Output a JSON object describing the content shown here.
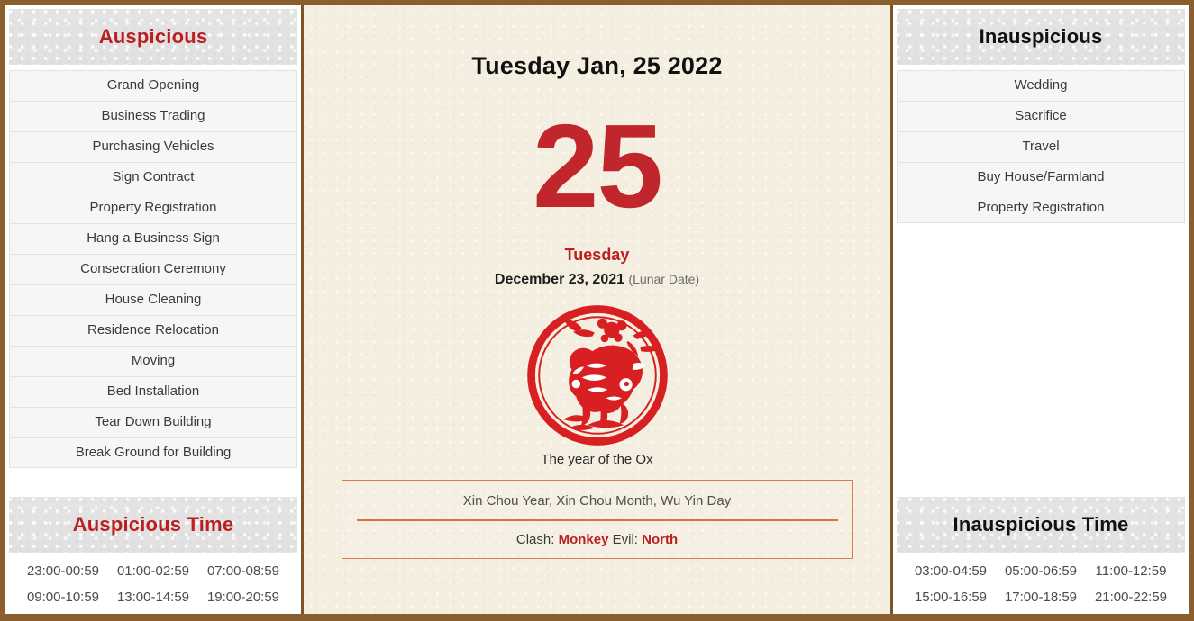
{
  "theme": {
    "frame_brown": "#8a5f2d",
    "accent_red": "#bb1f1f",
    "day_red": "#c0262c",
    "paper_cream": "#f4efe0",
    "box_orange": "#dc7a4c"
  },
  "left_panel": {
    "header": "Auspicious",
    "items": [
      "Grand Opening",
      "Business Trading",
      "Purchasing Vehicles",
      "Sign Contract",
      "Property Registration",
      "Hang a Business Sign",
      "Consecration Ceremony",
      "House Cleaning",
      "Residence Relocation",
      "Moving",
      "Bed Installation",
      "Tear Down Building",
      "Break Ground for Building"
    ],
    "time_header": "Auspicious Time",
    "times": [
      "23:00-00:59",
      "01:00-02:59",
      "07:00-08:59",
      "09:00-10:59",
      "13:00-14:59",
      "19:00-20:59"
    ]
  },
  "center": {
    "full_date": "Tuesday Jan, 25 2022",
    "day_number": "25",
    "weekday": "Tuesday",
    "lunar_date": "December 23, 2021",
    "lunar_tag": "(Lunar Date)",
    "zodiac_caption": "The year of the Ox",
    "zodiac_icon": "ox-papercut-icon",
    "ganzhi": "Xin Chou Year, Xin Chou Month, Wu Yin Day",
    "clash_prefix": "Clash:",
    "clash_value": "Monkey",
    "evil_prefix": "Evil:",
    "evil_value": "North"
  },
  "right_panel": {
    "header": "Inauspicious",
    "items": [
      "Wedding",
      "Sacrifice",
      "Travel",
      "Buy House/Farmland",
      "Property Registration"
    ],
    "time_header": "Inauspicious Time",
    "times": [
      "03:00-04:59",
      "05:00-06:59",
      "11:00-12:59",
      "15:00-16:59",
      "17:00-18:59",
      "21:00-22:59"
    ]
  }
}
